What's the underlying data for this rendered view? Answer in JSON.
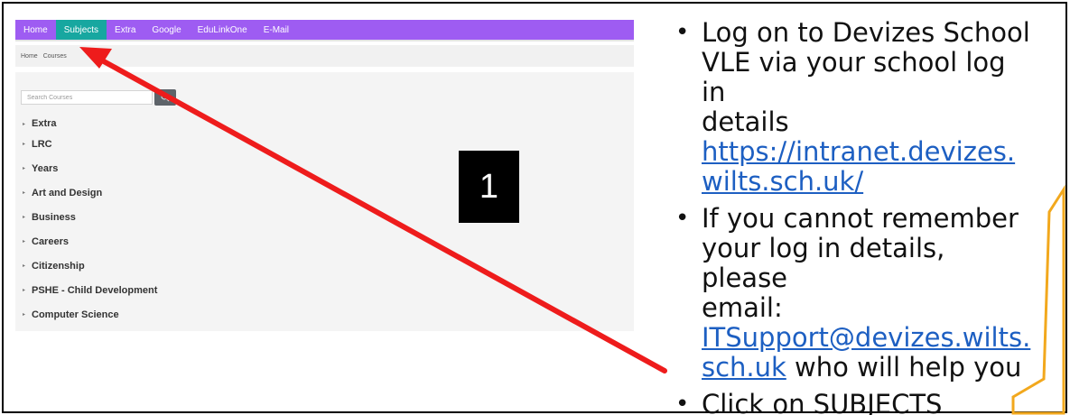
{
  "screenshot": {
    "nav": {
      "items": [
        {
          "label": "Home",
          "active": false
        },
        {
          "label": "Subjects",
          "active": true
        },
        {
          "label": "Extra",
          "active": false
        },
        {
          "label": "Google",
          "active": false
        },
        {
          "label": "EduLinkOne",
          "active": false
        },
        {
          "label": "E-Mail",
          "active": false
        }
      ],
      "bar_color": "#9e5cf2",
      "active_color": "#17a7a0"
    },
    "breadcrumb": [
      "Home",
      "Courses"
    ],
    "search": {
      "placeholder": "Search Courses",
      "button_icon": "search-icon"
    },
    "courses": [
      "Extra",
      "LRC",
      "Years",
      "Art and Design",
      "Business",
      "Careers",
      "Citizenship",
      "PSHE - Child Development",
      "Computer Science"
    ]
  },
  "step_badge": "1",
  "instructions": {
    "bullet1": {
      "lines": [
        "Log on to Devizes School",
        "VLE via your school log in",
        "details"
      ],
      "link_lines": [
        "https://intranet.devizes.",
        "wilts.sch.uk/"
      ]
    },
    "bullet2": {
      "lines": [
        "If you cannot remember",
        "your log in details, please",
        "email:"
      ],
      "link_lines": [
        "ITSupport@devizes.wilts.",
        "sch.uk"
      ],
      "trailing": "who will help you"
    },
    "bullet3": {
      "text": "Click on SUBJECTS"
    }
  },
  "colors": {
    "arrow": "#ee1c1c",
    "link": "#1d5fc2",
    "decoration": "#f2a81d"
  }
}
